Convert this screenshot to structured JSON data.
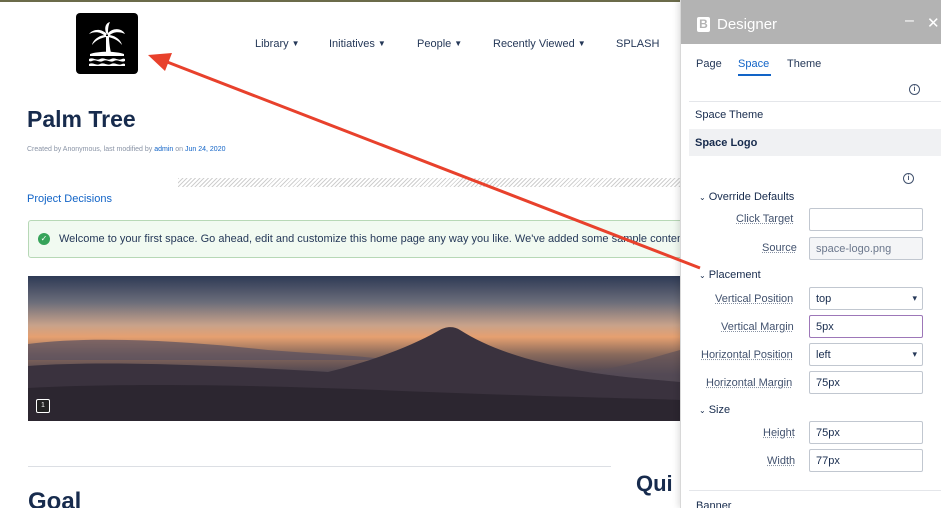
{
  "nav": {
    "items": [
      {
        "label": "Library",
        "dropdown": true
      },
      {
        "label": "Initiatives",
        "dropdown": true
      },
      {
        "label": "People",
        "dropdown": true
      },
      {
        "label": "Recently Viewed",
        "dropdown": true
      },
      {
        "label": "SPLASH",
        "dropdown": false
      }
    ]
  },
  "logo": {
    "icon": "palm-tree-icon"
  },
  "page": {
    "title": "Palm Tree",
    "meta_prefix": "Created by Anonymous, last modified by ",
    "meta_user": "admin",
    "meta_on": " on ",
    "meta_date": "Jun 24, 2020",
    "link": "Project Decisions",
    "welcome": "Welcome to your first space. Go ahead, edit and customize this home page any way you like. We've added some sample content to get you started.",
    "comment_count": "1",
    "heading_goal": "Goal",
    "heading_right": "Qui"
  },
  "designer": {
    "title": "Designer",
    "tabs": [
      "Page",
      "Space",
      "Theme"
    ],
    "active_tab": "Space",
    "space_theme_label": "Space Theme",
    "space_logo_label": "Space Logo",
    "override_defaults": "Override Defaults",
    "click_target_label": "Click Target",
    "click_target_value": "",
    "source_label": "Source",
    "source_value": "space-logo.png",
    "placement": "Placement",
    "vpos_label": "Vertical Position",
    "vpos_value": "top",
    "vmargin_label": "Vertical Margin",
    "vmargin_value": "5px",
    "hpos_label": "Horizontal Position",
    "hpos_value": "left",
    "hmargin_label": "Horizontal Margin",
    "hmargin_value": "75px",
    "size": "Size",
    "height_label": "Height",
    "height_value": "75px",
    "width_label": "Width",
    "width_value": "77px",
    "banner_label": "Banner"
  },
  "colors": {
    "accent": "#1264c7",
    "arrow": "#e8412c",
    "panel_header": "#b3b3b3",
    "success": "#36a35a"
  }
}
